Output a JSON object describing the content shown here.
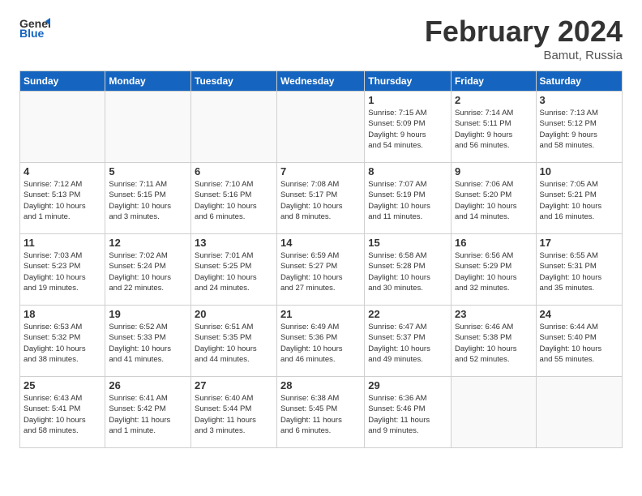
{
  "header": {
    "logo_general": "General",
    "logo_blue": "Blue",
    "month_title": "February 2024",
    "location": "Bamut, Russia"
  },
  "weekdays": [
    "Sunday",
    "Monday",
    "Tuesday",
    "Wednesday",
    "Thursday",
    "Friday",
    "Saturday"
  ],
  "weeks": [
    [
      {
        "day": "",
        "info": ""
      },
      {
        "day": "",
        "info": ""
      },
      {
        "day": "",
        "info": ""
      },
      {
        "day": "",
        "info": ""
      },
      {
        "day": "1",
        "info": "Sunrise: 7:15 AM\nSunset: 5:09 PM\nDaylight: 9 hours\nand 54 minutes."
      },
      {
        "day": "2",
        "info": "Sunrise: 7:14 AM\nSunset: 5:11 PM\nDaylight: 9 hours\nand 56 minutes."
      },
      {
        "day": "3",
        "info": "Sunrise: 7:13 AM\nSunset: 5:12 PM\nDaylight: 9 hours\nand 58 minutes."
      }
    ],
    [
      {
        "day": "4",
        "info": "Sunrise: 7:12 AM\nSunset: 5:13 PM\nDaylight: 10 hours\nand 1 minute."
      },
      {
        "day": "5",
        "info": "Sunrise: 7:11 AM\nSunset: 5:15 PM\nDaylight: 10 hours\nand 3 minutes."
      },
      {
        "day": "6",
        "info": "Sunrise: 7:10 AM\nSunset: 5:16 PM\nDaylight: 10 hours\nand 6 minutes."
      },
      {
        "day": "7",
        "info": "Sunrise: 7:08 AM\nSunset: 5:17 PM\nDaylight: 10 hours\nand 8 minutes."
      },
      {
        "day": "8",
        "info": "Sunrise: 7:07 AM\nSunset: 5:19 PM\nDaylight: 10 hours\nand 11 minutes."
      },
      {
        "day": "9",
        "info": "Sunrise: 7:06 AM\nSunset: 5:20 PM\nDaylight: 10 hours\nand 14 minutes."
      },
      {
        "day": "10",
        "info": "Sunrise: 7:05 AM\nSunset: 5:21 PM\nDaylight: 10 hours\nand 16 minutes."
      }
    ],
    [
      {
        "day": "11",
        "info": "Sunrise: 7:03 AM\nSunset: 5:23 PM\nDaylight: 10 hours\nand 19 minutes."
      },
      {
        "day": "12",
        "info": "Sunrise: 7:02 AM\nSunset: 5:24 PM\nDaylight: 10 hours\nand 22 minutes."
      },
      {
        "day": "13",
        "info": "Sunrise: 7:01 AM\nSunset: 5:25 PM\nDaylight: 10 hours\nand 24 minutes."
      },
      {
        "day": "14",
        "info": "Sunrise: 6:59 AM\nSunset: 5:27 PM\nDaylight: 10 hours\nand 27 minutes."
      },
      {
        "day": "15",
        "info": "Sunrise: 6:58 AM\nSunset: 5:28 PM\nDaylight: 10 hours\nand 30 minutes."
      },
      {
        "day": "16",
        "info": "Sunrise: 6:56 AM\nSunset: 5:29 PM\nDaylight: 10 hours\nand 32 minutes."
      },
      {
        "day": "17",
        "info": "Sunrise: 6:55 AM\nSunset: 5:31 PM\nDaylight: 10 hours\nand 35 minutes."
      }
    ],
    [
      {
        "day": "18",
        "info": "Sunrise: 6:53 AM\nSunset: 5:32 PM\nDaylight: 10 hours\nand 38 minutes."
      },
      {
        "day": "19",
        "info": "Sunrise: 6:52 AM\nSunset: 5:33 PM\nDaylight: 10 hours\nand 41 minutes."
      },
      {
        "day": "20",
        "info": "Sunrise: 6:51 AM\nSunset: 5:35 PM\nDaylight: 10 hours\nand 44 minutes."
      },
      {
        "day": "21",
        "info": "Sunrise: 6:49 AM\nSunset: 5:36 PM\nDaylight: 10 hours\nand 46 minutes."
      },
      {
        "day": "22",
        "info": "Sunrise: 6:47 AM\nSunset: 5:37 PM\nDaylight: 10 hours\nand 49 minutes."
      },
      {
        "day": "23",
        "info": "Sunrise: 6:46 AM\nSunset: 5:38 PM\nDaylight: 10 hours\nand 52 minutes."
      },
      {
        "day": "24",
        "info": "Sunrise: 6:44 AM\nSunset: 5:40 PM\nDaylight: 10 hours\nand 55 minutes."
      }
    ],
    [
      {
        "day": "25",
        "info": "Sunrise: 6:43 AM\nSunset: 5:41 PM\nDaylight: 10 hours\nand 58 minutes."
      },
      {
        "day": "26",
        "info": "Sunrise: 6:41 AM\nSunset: 5:42 PM\nDaylight: 11 hours\nand 1 minute."
      },
      {
        "day": "27",
        "info": "Sunrise: 6:40 AM\nSunset: 5:44 PM\nDaylight: 11 hours\nand 3 minutes."
      },
      {
        "day": "28",
        "info": "Sunrise: 6:38 AM\nSunset: 5:45 PM\nDaylight: 11 hours\nand 6 minutes."
      },
      {
        "day": "29",
        "info": "Sunrise: 6:36 AM\nSunset: 5:46 PM\nDaylight: 11 hours\nand 9 minutes."
      },
      {
        "day": "",
        "info": ""
      },
      {
        "day": "",
        "info": ""
      }
    ]
  ]
}
